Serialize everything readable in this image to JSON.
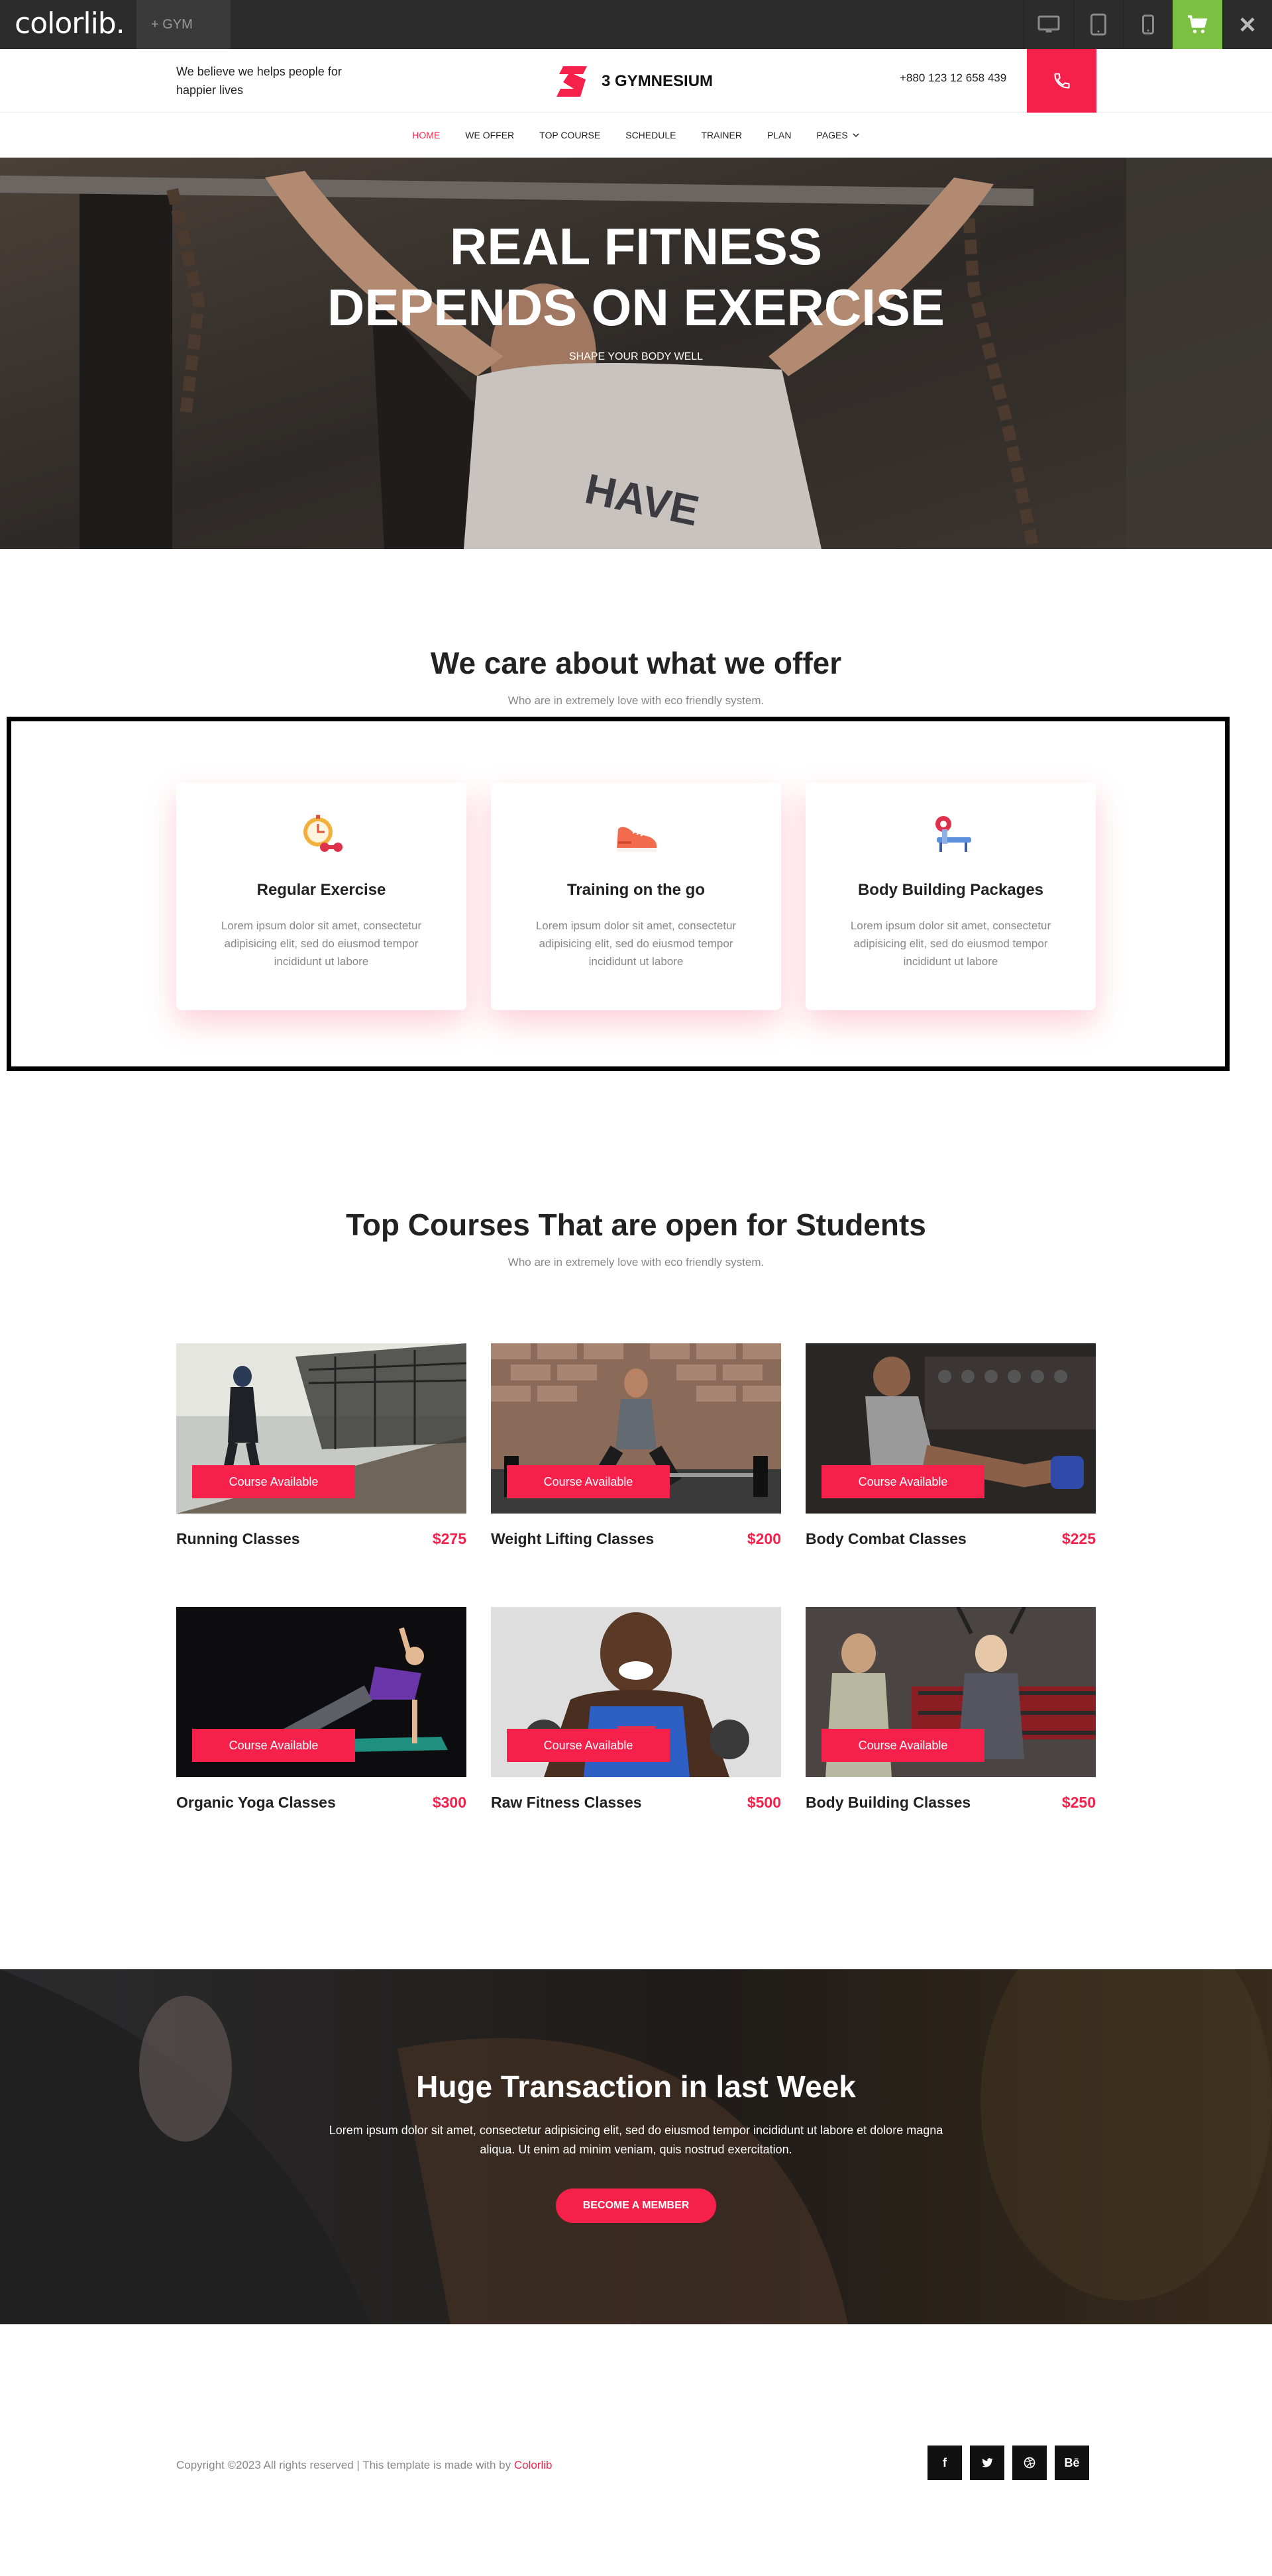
{
  "topbar": {
    "logo": "colorlib.",
    "tab_label": "+ GYM",
    "devices": [
      "desktop-icon",
      "tablet-icon",
      "mobile-icon"
    ],
    "cart_color": "#7bc043"
  },
  "header": {
    "tagline": "We believe we helps people for happier lives",
    "brand_name": "3 GYMNESIUM",
    "phone": "+880 123 12 658 439",
    "accent_color": "#f6214b"
  },
  "nav": {
    "items": [
      {
        "label": "HOME",
        "active": true
      },
      {
        "label": "WE OFFER"
      },
      {
        "label": "TOP COURSE"
      },
      {
        "label": "SCHEDULE"
      },
      {
        "label": "TRAINER"
      },
      {
        "label": "PLAN"
      },
      {
        "label": "PAGES",
        "has_dropdown": true
      }
    ]
  },
  "hero": {
    "title_line1": "REAL FITNESS",
    "title_line2": "DEPENDS ON EXERCISE",
    "subtitle": "SHAPE YOUR BODY WELL"
  },
  "offer": {
    "title": "We care about what we offer",
    "subtitle": "Who are in extremely love with eco friendly system.",
    "cards": [
      {
        "icon": "stopwatch-dumbbell-icon",
        "title": "Regular Exercise",
        "text": "Lorem ipsum dolor sit amet, consectetur adipisicing elit, sed do eiusmod tempor incididunt ut labore"
      },
      {
        "icon": "sneaker-icon",
        "title": "Training on the go",
        "text": "Lorem ipsum dolor sit amet, consectetur adipisicing elit, sed do eiusmod tempor incididunt ut labore"
      },
      {
        "icon": "bench-press-icon",
        "title": "Body Building Packages",
        "text": "Lorem ipsum dolor sit amet, consectetur adipisicing elit, sed do eiusmod tempor incididunt ut labore"
      }
    ]
  },
  "courses": {
    "title": "Top Courses That are open for Students",
    "subtitle": "Who are in extremely love with eco friendly system.",
    "badge_label": "Course Available",
    "items": [
      {
        "name": "Running Classes",
        "price": "$275"
      },
      {
        "name": "Weight Lifting Classes",
        "price": "$200"
      },
      {
        "name": "Body Combat Classes",
        "price": "$225"
      },
      {
        "name": "Organic Yoga Classes",
        "price": "$300"
      },
      {
        "name": "Raw Fitness Classes",
        "price": "$500"
      },
      {
        "name": "Body Building Classes",
        "price": "$250"
      }
    ]
  },
  "cta": {
    "title": "Huge Transaction in last Week",
    "text": "Lorem ipsum dolor sit amet, consectetur adipisicing elit, sed do eiusmod tempor incididunt ut labore et dolore magna aliqua. Ut enim ad minim veniam, quis nostrud exercitation.",
    "button": "BECOME A MEMBER"
  },
  "footer": {
    "copyright": "Copyright ©2023 All rights reserved | This template is made with by ",
    "credit": "Colorlib",
    "socials": [
      {
        "icon": "facebook-icon",
        "glyph": "f"
      },
      {
        "icon": "twitter-icon",
        "glyph": ""
      },
      {
        "icon": "dribbble-icon",
        "glyph": ""
      },
      {
        "icon": "behance-icon",
        "glyph": "Bē"
      }
    ]
  }
}
